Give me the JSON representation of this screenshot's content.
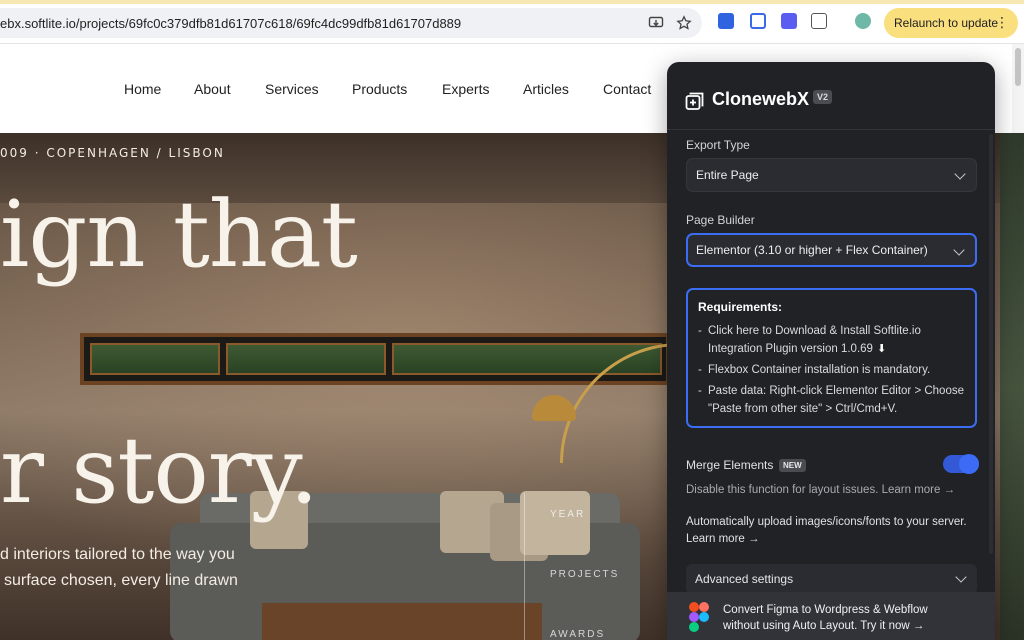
{
  "browser": {
    "url": "ebx.softlite.io/projects/69fc0c379dfb81d61707c618/69fc4dc99dfb81d61707d889",
    "relaunch_label": "Relaunch to update",
    "menu_icon": "more-vert-icon"
  },
  "nav": {
    "items": [
      "Home",
      "About",
      "Services",
      "Products",
      "Experts",
      "Articles",
      "Contact"
    ]
  },
  "hero": {
    "tagline": "009 · COPENHAGEN / LISBON",
    "heading_line1": "ign that",
    "heading_line2": "r story.",
    "sub_line1": "d interiors tailored to the way you",
    "sub_line2": "surface chosen, every line drawn",
    "side_labels": [
      "YEAR",
      "PROJECTS",
      "AWARDS"
    ]
  },
  "panel": {
    "brand": "ClonewebX",
    "version_badge": "V2",
    "export_type": {
      "label": "Export Type",
      "value": "Entire Page"
    },
    "page_builder": {
      "label": "Page Builder",
      "value": "Elementor (3.10 or higher + Flex Container)"
    },
    "requirements": {
      "title": "Requirements:",
      "items": [
        "Click here to Download & Install Softlite.io Integration Plugin version 1.0.69",
        "Flexbox Container installation is mandatory.",
        "Paste data: Right-click Elementor Editor > Choose \"Paste from other site\" > Ctrl/Cmd+V."
      ]
    },
    "merge": {
      "label": "Merge Elements",
      "badge": "NEW",
      "enabled": true,
      "help": "Disable this function for layout issues. Learn more →"
    },
    "auto_upload_text": "Automatically upload images/icons/fonts to your server. Learn more →",
    "advanced_label": "Advanced settings",
    "promo": {
      "line1": "Convert Figma to Wordpress & Webflow",
      "line2": "without using Auto Layout. Try it now →"
    }
  },
  "colors": {
    "accent": "#3b6cf4",
    "panel_bg": "#212226",
    "relaunch_bg": "#f9df7d"
  }
}
